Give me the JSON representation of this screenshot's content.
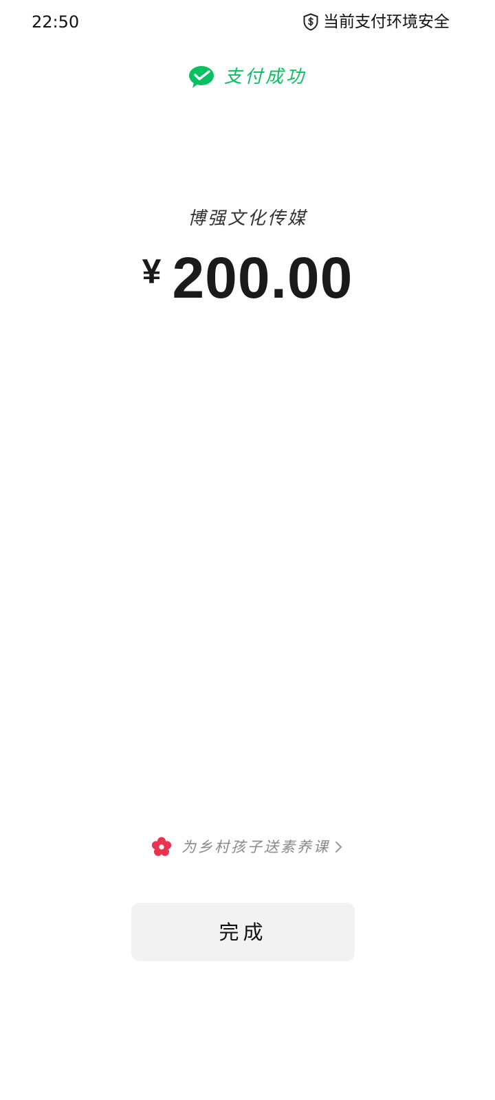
{
  "status_bar": {
    "time": "22:50",
    "security_text": "当前支付环境安全",
    "security_icon": "shield-dollar-icon"
  },
  "header": {
    "icon": "wechat-pay-icon",
    "title": "支付成功",
    "accent_color": "#07c160"
  },
  "payment": {
    "merchant": "博强文化传媒",
    "currency_symbol": "¥",
    "amount": "200.00"
  },
  "charity": {
    "icon": "flower-icon",
    "text": "为乡村孩子送素养课",
    "chevron": "chevron-right-icon",
    "icon_color": "#e8344e"
  },
  "actions": {
    "done_label": "完成"
  }
}
